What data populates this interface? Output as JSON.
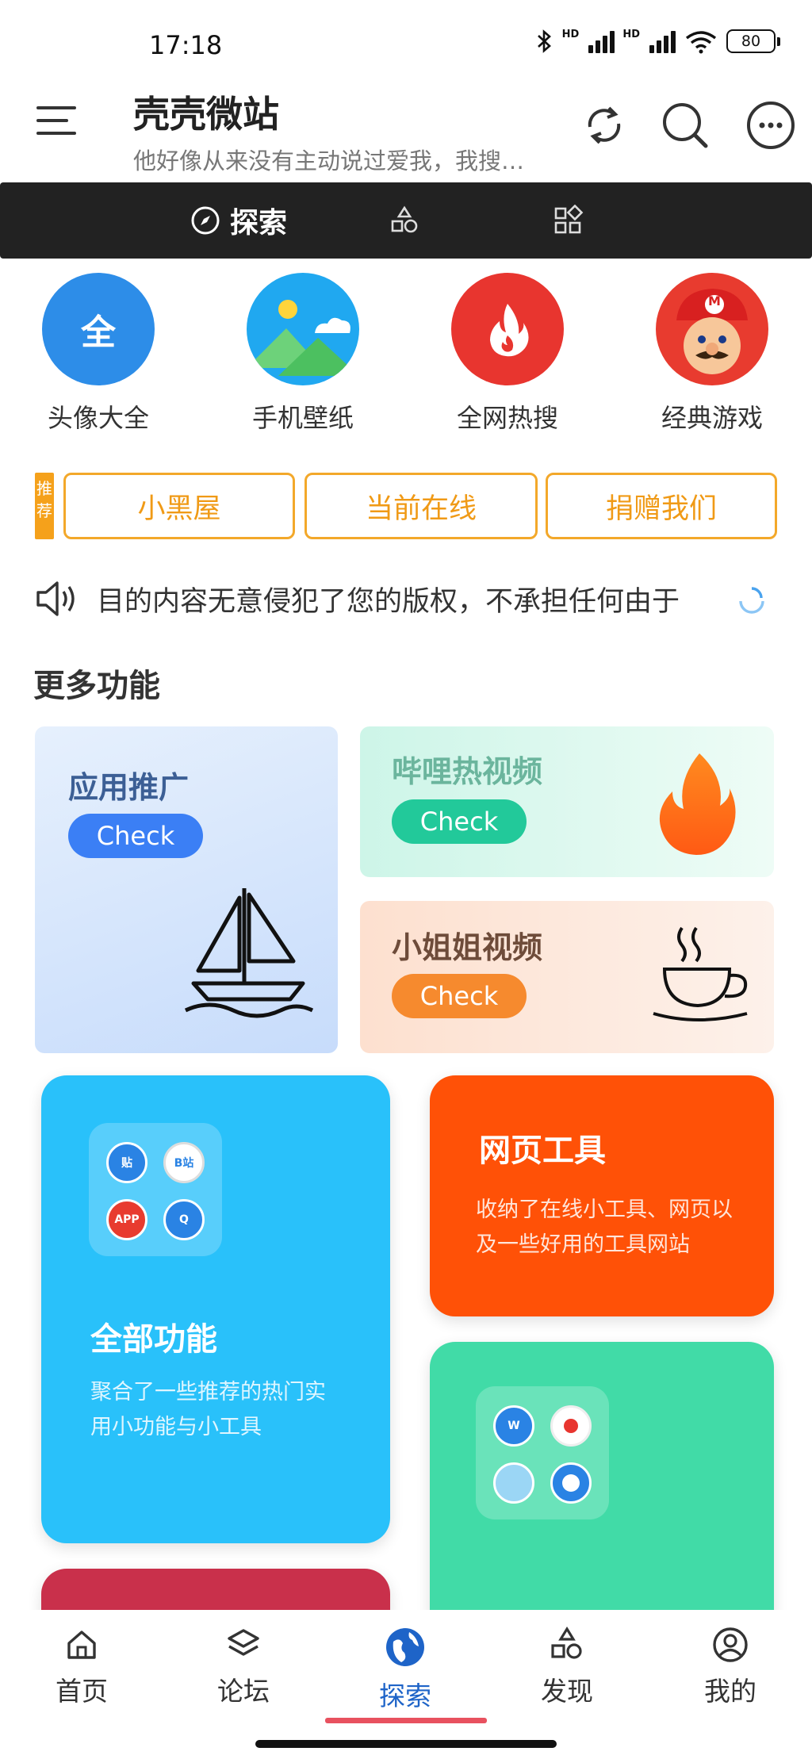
{
  "status_bar": {
    "time": "17:18",
    "battery": "80",
    "signal_label": "HD"
  },
  "header": {
    "title": "壳壳微站",
    "subtitle": "他好像从来没有主动说过爱我，我搜…"
  },
  "top_tabs": [
    {
      "label": "探索"
    }
  ],
  "categories": [
    {
      "label": "头像大全",
      "icon_text": "全",
      "color": "#2d8de8"
    },
    {
      "label": "手机壁纸",
      "color": "#20a8f0"
    },
    {
      "label": "全网热搜",
      "color": "#e8352f"
    },
    {
      "label": "经典游戏",
      "color": "#e83b2f",
      "badge": "M"
    }
  ],
  "recommend": {
    "tag": "推荐",
    "buttons": [
      {
        "label": "小黑屋"
      },
      {
        "label": "当前在线"
      },
      {
        "label": "捐赠我们"
      }
    ]
  },
  "notice": {
    "text": "目的内容无意侵犯了您的版权，不承担任何由于"
  },
  "section_title": "更多功能",
  "feature_cards": [
    {
      "title": "应用推广",
      "button": "Check",
      "accent": "#3b7ff5"
    },
    {
      "title": "哔哩热视频",
      "button": "Check",
      "accent": "#22c99a"
    },
    {
      "title": "小姐姐视频",
      "button": "Check",
      "accent": "#f68a2e"
    }
  ],
  "big_cards": [
    {
      "title": "全部功能",
      "desc_line1": "聚合了一些推荐的热门实",
      "desc_line2": "用小功能与小工具",
      "color": "#29c1fa",
      "folder_icons": [
        "贴",
        "B站",
        "APP",
        "Q"
      ]
    },
    {
      "title": "网页工具",
      "desc_line1": "收纳了在线小工具、网页以",
      "desc_line2": "及一些好用的工具网站",
      "color": "#ff5107"
    },
    {
      "title": "",
      "color": "#41dba7"
    },
    {
      "title": "",
      "color": "#c9304b"
    }
  ],
  "bottom_nav": [
    {
      "label": "首页",
      "icon": "home-icon"
    },
    {
      "label": "论坛",
      "icon": "layers-icon"
    },
    {
      "label": "探索",
      "icon": "globe-icon",
      "active": true
    },
    {
      "label": "发现",
      "icon": "shapes-icon"
    },
    {
      "label": "我的",
      "icon": "user-icon"
    }
  ]
}
